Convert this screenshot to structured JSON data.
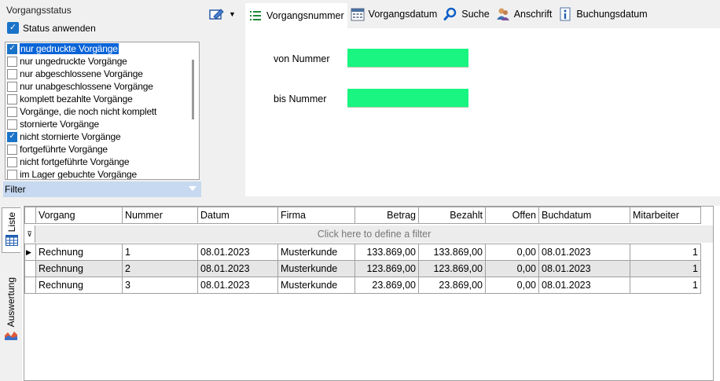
{
  "status": {
    "title": "Vorgangsstatus",
    "apply_label": "Status anwenden",
    "apply_checked": true,
    "items": [
      {
        "label": "nur gedruckte Vorgänge",
        "checked": true,
        "selected": true
      },
      {
        "label": "nur ungedruckte Vorgänge",
        "checked": false
      },
      {
        "label": "nur abgeschlossene Vorgänge",
        "checked": false
      },
      {
        "label": "nur unabgeschlossene Vorgänge",
        "checked": false
      },
      {
        "label": "komplett bezahlte Vorgänge",
        "checked": false
      },
      {
        "label": "Vorgänge, die noch nicht komplett",
        "checked": false
      },
      {
        "label": "stornierte Vorgänge",
        "checked": false
      },
      {
        "label": "nicht stornierte Vorgänge",
        "checked": true
      },
      {
        "label": "fortgeführte Vorgänge",
        "checked": false
      },
      {
        "label": "nicht fortgeführte Vorgänge",
        "checked": false
      },
      {
        "label": "im Lager gebuchte Vorgänge",
        "checked": false
      }
    ],
    "filter_label": "Filter"
  },
  "tabs": [
    {
      "label": "Vorgangsnummer",
      "icon": "list-icon",
      "active": true
    },
    {
      "label": "Vorgangsdatum",
      "icon": "calendar-icon"
    },
    {
      "label": "Suche",
      "icon": "search-icon"
    },
    {
      "label": "Anschrift",
      "icon": "contacts-icon"
    },
    {
      "label": "Buchungsdatum",
      "icon": "info-icon"
    }
  ],
  "panel": {
    "from_label": "von Nummer",
    "to_label": "bis Nummer",
    "from_value": "",
    "to_value": ""
  },
  "side_tabs": {
    "list": "Liste",
    "analysis": "Auswertung"
  },
  "grid": {
    "columns": [
      "Vorgang",
      "Nummer",
      "Datum",
      "Firma",
      "Betrag",
      "Bezahlt",
      "Offen",
      "Buchdatum",
      "Mitarbeiter"
    ],
    "filter_hint": "Click here to define a filter",
    "rows": [
      [
        "Rechnung",
        "1",
        "08.01.2023",
        "Musterkunde",
        "133.869,00",
        "133.869,00",
        "0,00",
        "08.01.2023",
        "1"
      ],
      [
        "Rechnung",
        "2",
        "08.01.2023",
        "Musterkunde",
        "123.869,00",
        "123.869,00",
        "0,00",
        "08.01.2023",
        "1"
      ],
      [
        "Rechnung",
        "3",
        "08.01.2023",
        "Musterkunde",
        "23.869,00",
        "23.869,00",
        "0,00",
        "08.01.2023",
        "1"
      ]
    ]
  },
  "colors": {
    "accent": "#0a64d8",
    "input_green": "#19f580",
    "filter_bar": "#c7d9f0",
    "alt_row": "#e6e6e6"
  }
}
